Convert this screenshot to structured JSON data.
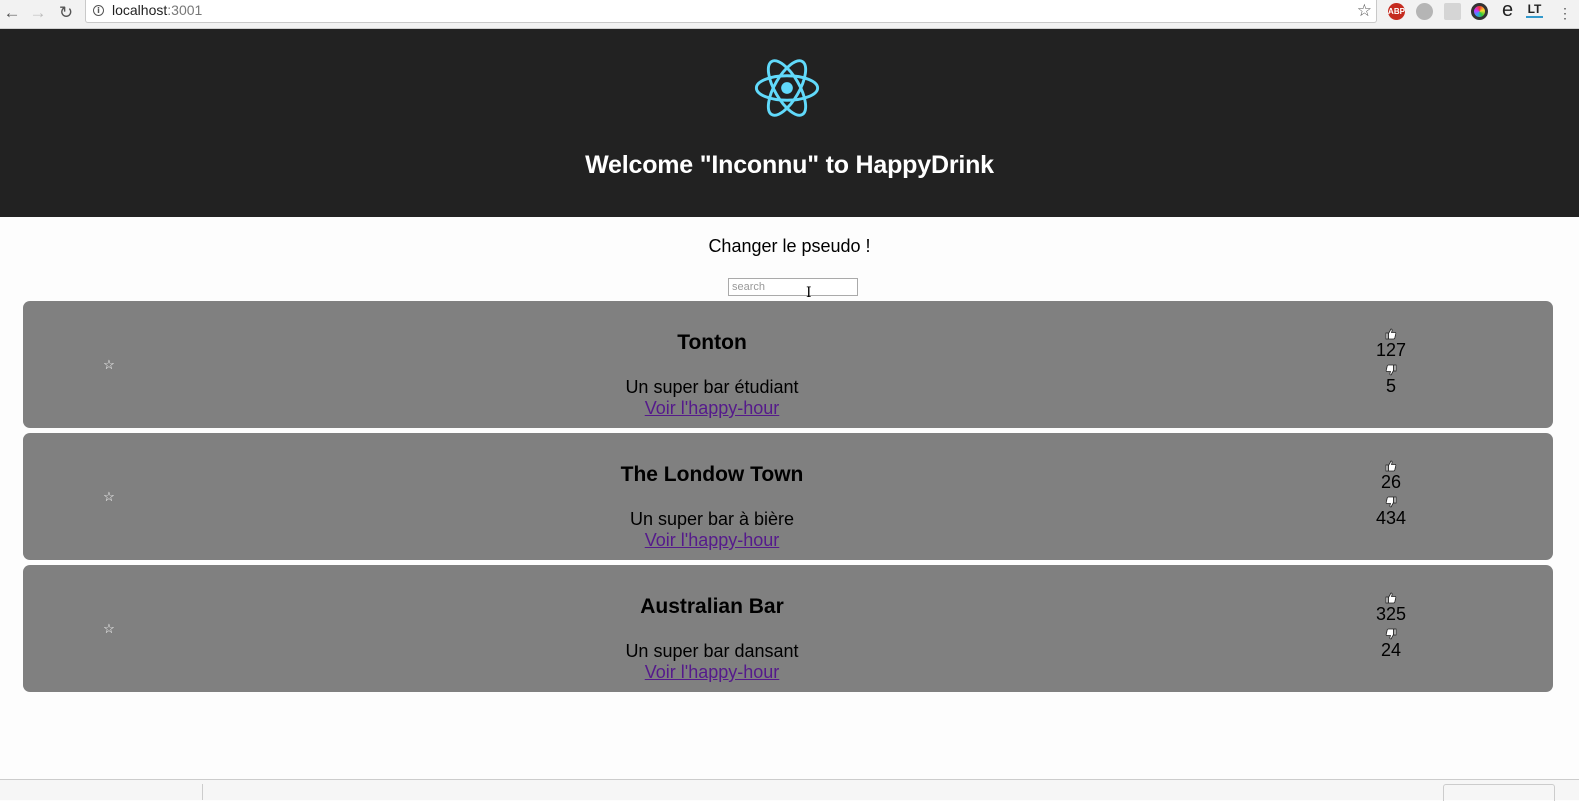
{
  "browser": {
    "url_host": "localhost",
    "url_port": ":3001",
    "extensions": [
      {
        "name": "adblock-icon",
        "label": "ABP",
        "color": "#c52b1f"
      },
      {
        "name": "extension-grey-icon",
        "label": "",
        "color": "#b5b5b5"
      },
      {
        "name": "extension-grid-icon",
        "label": "",
        "color": "#d5d5d5"
      },
      {
        "name": "extension-color-wheel-icon",
        "label": "",
        "color": "#333333"
      },
      {
        "name": "extension-e-icon",
        "label": "e",
        "color": "#ffffff"
      },
      {
        "name": "extension-lt-icon",
        "label": "LT",
        "color": "#ffffff"
      }
    ]
  },
  "header": {
    "title": "Welcome \"Inconnu\" to HappyDrink",
    "logo_color": "#61dafb",
    "background": "#222222"
  },
  "main": {
    "change_pseudo": "Changer le pseudo !",
    "search_placeholder": "search"
  },
  "bars": [
    {
      "name": "Tonton",
      "description": "Un super bar étudiant",
      "link": "Voir l'happy-hour",
      "likes": "127",
      "dislikes": "5"
    },
    {
      "name": "The Londow Town",
      "description": "Un super bar à bière",
      "link": "Voir l'happy-hour",
      "likes": "26",
      "dislikes": "434"
    },
    {
      "name": "Australian Bar",
      "description": "Un super bar dansant",
      "link": "Voir l'happy-hour",
      "likes": "325",
      "dislikes": "24"
    }
  ],
  "colors": {
    "card_background": "#808080",
    "link": "#551a8b"
  }
}
